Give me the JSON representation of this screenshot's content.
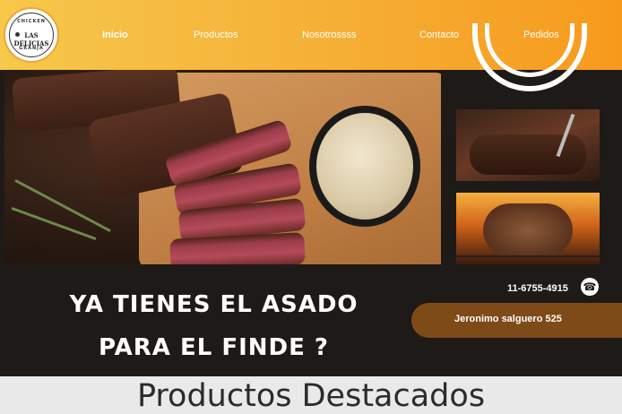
{
  "logo": {
    "top_text": "CHICKEN",
    "main_text": "LAS DELICIAS",
    "bottom_text": "GRANJA"
  },
  "nav": {
    "items": [
      {
        "label": "Inicio",
        "active": true
      },
      {
        "label": "Productos",
        "active": false
      },
      {
        "label": "Nosotrossss",
        "active": false
      },
      {
        "label": "Contacto",
        "active": false
      },
      {
        "label": "Pedidos",
        "active": false
      }
    ]
  },
  "hero": {
    "slogan_line1": "YA TIENES EL ASADO",
    "slogan_line2": "PARA EL FINDE ?",
    "phone": "11-6755-4915",
    "phone_icon": "phone-icon",
    "address": "Jeronimo salguero 525"
  },
  "section": {
    "title": "Productos Destacados"
  },
  "colors": {
    "header_start": "#f7c84a",
    "header_end": "#f79a1c",
    "hero_bg": "#1e1a17",
    "address_bg": "#7e4a18"
  }
}
